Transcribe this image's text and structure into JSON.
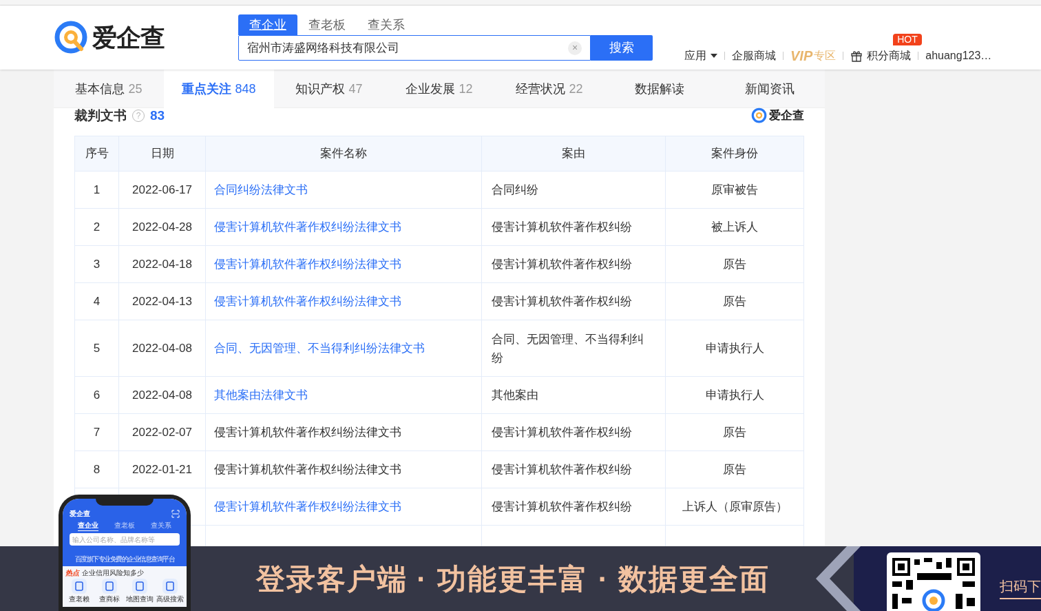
{
  "header": {
    "logo_text": "爱企查",
    "search_tabs": [
      {
        "label": "查企业",
        "selected": true
      },
      {
        "label": "查老板",
        "selected": false
      },
      {
        "label": "查关系",
        "selected": false
      }
    ],
    "search_value": "宿州市涛盛网络科技有限公司",
    "clear_icon": "×",
    "search_button": "搜索",
    "nav": [
      {
        "kind": "dropdown",
        "label": "应用"
      },
      {
        "kind": "text",
        "label": "企服商城"
      },
      {
        "kind": "vip",
        "label": "VIP",
        "suffix": "专区"
      },
      {
        "kind": "gift",
        "label": "积分商城",
        "badge": "HOT"
      },
      {
        "kind": "text",
        "label": "ahuang123…"
      }
    ]
  },
  "tabs": [
    {
      "label": "基本信息",
      "count": "25",
      "selected": false
    },
    {
      "label": "重点关注",
      "count": "848",
      "selected": true
    },
    {
      "label": "知识产权",
      "count": "47",
      "selected": false
    },
    {
      "label": "企业发展",
      "count": "12",
      "selected": false
    },
    {
      "label": "经营状况",
      "count": "22",
      "selected": false
    },
    {
      "label": "数据解读",
      "selected": false
    },
    {
      "label": "新闻资讯",
      "selected": false
    }
  ],
  "section": {
    "title": "裁判文书",
    "help_icon": "?",
    "count": "83",
    "brand": "爱企查"
  },
  "table": {
    "columns": [
      "序号",
      "日期",
      "案件名称",
      "案由",
      "案件身份"
    ],
    "rows": [
      {
        "no": "1",
        "date": "2022-06-17",
        "name": "合同纠纷法律文书",
        "link": true,
        "cause": "合同纠纷",
        "role": "原审被告"
      },
      {
        "no": "2",
        "date": "2022-04-28",
        "name": "侵害计算机软件著作权纠纷法律文书",
        "link": true,
        "cause": "侵害计算机软件著作权纠纷",
        "role": "被上诉人"
      },
      {
        "no": "3",
        "date": "2022-04-18",
        "name": "侵害计算机软件著作权纠纷法律文书",
        "link": true,
        "cause": "侵害计算机软件著作权纠纷",
        "role": "原告"
      },
      {
        "no": "4",
        "date": "2022-04-13",
        "name": "侵害计算机软件著作权纠纷法律文书",
        "link": true,
        "cause": "侵害计算机软件著作权纠纷",
        "role": "原告"
      },
      {
        "no": "5",
        "date": "2022-04-08",
        "name": "合同、无因管理、不当得利纠纷法律文书",
        "link": true,
        "cause": "合同、无因管理、不当得利纠纷",
        "role": "申请执行人"
      },
      {
        "no": "6",
        "date": "2022-04-08",
        "name": "其他案由法律文书",
        "link": true,
        "cause": "其他案由",
        "role": "申请执行人"
      },
      {
        "no": "7",
        "date": "2022-02-07",
        "name": "侵害计算机软件著作权纠纷法律文书",
        "link": false,
        "cause": "侵害计算机软件著作权纠纷",
        "role": "原告"
      },
      {
        "no": "8",
        "date": "2022-01-21",
        "name": "侵害计算机软件著作权纠纷法律文书",
        "link": false,
        "cause": "侵害计算机软件著作权纠纷",
        "role": "原告"
      },
      {
        "name": "侵害计算机软件著作权纠纷法律文书",
        "link": true,
        "cause": "侵害计算机软件著作权纠纷",
        "role": "上诉人（原审原告）"
      }
    ]
  },
  "phone": {
    "logo": "爱企查",
    "tabs": [
      {
        "label": "查企业",
        "selected": true
      },
      {
        "label": "查老板",
        "selected": false
      },
      {
        "label": "查关系",
        "selected": false
      }
    ],
    "placeholder": "输入公司名称、品牌名称等",
    "slogan": "百度旗下专业免费的企业信息查询平台",
    "hot_label": "热点",
    "hot_items": [
      "企业信用风险知多少"
    ],
    "apps": [
      "查老赖",
      "查商标",
      "地图查询",
      "高级搜索"
    ]
  },
  "banner": {
    "slogan": "登录客户端 · 功能更丰富 · 数据更全面",
    "qr_caption": "扫码下"
  }
}
